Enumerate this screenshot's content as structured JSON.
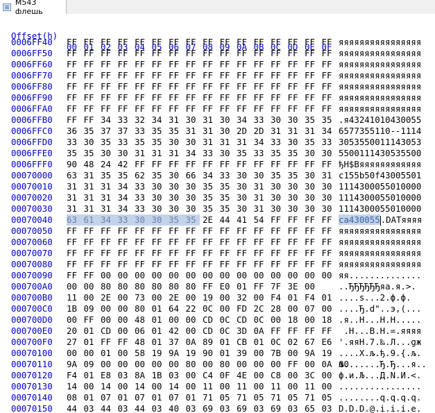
{
  "tab": {
    "label": "M543 флешь",
    "icon": "document-icon"
  },
  "header": {
    "offset_label": "Offset(h)",
    "columns": [
      "00",
      "01",
      "02",
      "03",
      "04",
      "05",
      "06",
      "07",
      "08",
      "09",
      "0A",
      "0B",
      "0C",
      "0D",
      "0E",
      "0F"
    ]
  },
  "selection_color": "#c3d3ea",
  "offset_color": "#0000c8",
  "rows": [
    {
      "offset": "0006FF40",
      "hex": [
        "FF",
        "FF",
        "FF",
        "FF",
        "FF",
        "FF",
        "FF",
        "FF",
        "FF",
        "FF",
        "FF",
        "FF",
        "FF",
        "FF",
        "FF",
        "FF"
      ],
      "ascii": "яяяяяяяяяяяяяяяя"
    },
    {
      "offset": "0006FF50",
      "hex": [
        "FF",
        "FF",
        "FF",
        "FF",
        "FF",
        "FF",
        "FF",
        "FF",
        "FF",
        "FF",
        "FF",
        "FF",
        "FF",
        "FF",
        "FF",
        "FF"
      ],
      "ascii": "яяяяяяяяяяяяяяяя"
    },
    {
      "offset": "0006FF60",
      "hex": [
        "FF",
        "FF",
        "FF",
        "FF",
        "FF",
        "FF",
        "FF",
        "FF",
        "FF",
        "FF",
        "FF",
        "FF",
        "FF",
        "FF",
        "FF",
        "FF"
      ],
      "ascii": "яяяяяяяяяяяяяяяя"
    },
    {
      "offset": "0006FF70",
      "hex": [
        "FF",
        "FF",
        "FF",
        "FF",
        "FF",
        "FF",
        "FF",
        "FF",
        "FF",
        "FF",
        "FF",
        "FF",
        "FF",
        "FF",
        "FF",
        "FF"
      ],
      "ascii": "яяяяяяяяяяяяяяяя"
    },
    {
      "offset": "0006FF80",
      "hex": [
        "FF",
        "FF",
        "FF",
        "FF",
        "FF",
        "FF",
        "FF",
        "FF",
        "FF",
        "FF",
        "FF",
        "FF",
        "FF",
        "FF",
        "FF",
        "FF"
      ],
      "ascii": "яяяяяяяяяяяяяяяя"
    },
    {
      "offset": "0006FF90",
      "hex": [
        "FF",
        "FF",
        "FF",
        "FF",
        "FF",
        "FF",
        "FF",
        "FF",
        "FF",
        "FF",
        "FF",
        "FF",
        "FF",
        "FF",
        "FF",
        "FF"
      ],
      "ascii": "яяяяяяяяяяяяяяяя"
    },
    {
      "offset": "0006FFA0",
      "hex": [
        "FF",
        "FF",
        "FF",
        "FF",
        "FF",
        "FF",
        "FF",
        "FF",
        "FF",
        "FF",
        "FF",
        "FF",
        "FF",
        "FF",
        "FF",
        "FF"
      ],
      "ascii": "яяяяяяяяяяяяяяяя"
    },
    {
      "offset": "0006FFB0",
      "hex": [
        "FF",
        "FF",
        "34",
        "33",
        "32",
        "34",
        "31",
        "30",
        "31",
        "30",
        "34",
        "33",
        "30",
        "30",
        "35",
        "35"
      ],
      "ascii": ".я43241010430055"
    },
    {
      "offset": "0006FFC0",
      "hex": [
        "36",
        "35",
        "37",
        "37",
        "33",
        "35",
        "35",
        "31",
        "31",
        "30",
        "2D",
        "2D",
        "31",
        "31",
        "31",
        "34"
      ],
      "ascii": "6577355110--1114"
    },
    {
      "offset": "0006FFD0",
      "hex": [
        "33",
        "30",
        "35",
        "33",
        "35",
        "35",
        "30",
        "30",
        "31",
        "31",
        "31",
        "34",
        "33",
        "30",
        "35",
        "33"
      ],
      "ascii": "3053550011143053"
    },
    {
      "offset": "0006FFE0",
      "hex": [
        "35",
        "35",
        "30",
        "30",
        "31",
        "31",
        "31",
        "34",
        "33",
        "30",
        "35",
        "33",
        "35",
        "35",
        "30",
        "30"
      ],
      "ascii": "5500111430535500"
    },
    {
      "offset": "0006FFF0",
      "hex": [
        "90",
        "48",
        "24",
        "42",
        "FF",
        "FF",
        "FF",
        "FF",
        "FF",
        "FF",
        "FF",
        "FF",
        "FF",
        "FF",
        "FF",
        "FF"
      ],
      "ascii": "ђH$Bяяяяяяяяяяяя"
    },
    {
      "offset": "00070000",
      "hex": [
        "63",
        "31",
        "35",
        "35",
        "62",
        "35",
        "30",
        "66",
        "34",
        "33",
        "30",
        "30",
        "35",
        "35",
        "30",
        "31"
      ],
      "ascii": "c155b50f43005501"
    },
    {
      "offset": "00070010",
      "hex": [
        "31",
        "31",
        "31",
        "34",
        "33",
        "30",
        "30",
        "30",
        "35",
        "35",
        "30",
        "31",
        "30",
        "30",
        "30",
        "30"
      ],
      "ascii": "1114300055010000"
    },
    {
      "offset": "00070020",
      "hex": [
        "31",
        "31",
        "31",
        "34",
        "33",
        "30",
        "30",
        "30",
        "35",
        "35",
        "30",
        "31",
        "30",
        "30",
        "30",
        "30"
      ],
      "ascii": "1114300055010000"
    },
    {
      "offset": "00070030",
      "hex": [
        "31",
        "31",
        "31",
        "34",
        "33",
        "30",
        "30",
        "30",
        "35",
        "35",
        "30",
        "31",
        "30",
        "30",
        "30",
        "30"
      ],
      "ascii": "1114300055010000"
    },
    {
      "offset": "00070040",
      "hex": [
        "63",
        "61",
        "34",
        "33",
        "30",
        "30",
        "35",
        "35",
        "2E",
        "44",
        "41",
        "54",
        "FF",
        "FF",
        "FF",
        "FF"
      ],
      "ascii": "ca430055.DATяяяя",
      "sel_count": 8
    },
    {
      "offset": "00070050",
      "hex": [
        "FF",
        "FF",
        "FF",
        "FF",
        "FF",
        "FF",
        "FF",
        "FF",
        "FF",
        "FF",
        "FF",
        "FF",
        "FF",
        "FF",
        "FF",
        "FF"
      ],
      "ascii": "яяяяяяяяяяяяяяяя"
    },
    {
      "offset": "00070060",
      "hex": [
        "FF",
        "FF",
        "FF",
        "FF",
        "FF",
        "FF",
        "FF",
        "FF",
        "FF",
        "FF",
        "FF",
        "FF",
        "FF",
        "FF",
        "FF",
        "FF"
      ],
      "ascii": "яяяяяяяяяяяяяяяя"
    },
    {
      "offset": "00070070",
      "hex": [
        "FF",
        "FF",
        "FF",
        "FF",
        "FF",
        "FF",
        "FF",
        "FF",
        "FF",
        "FF",
        "FF",
        "FF",
        "FF",
        "FF",
        "FF",
        "FF"
      ],
      "ascii": "яяяяяяяяяяяяяяяя"
    },
    {
      "offset": "00070080",
      "hex": [
        "FF",
        "FF",
        "FF",
        "FF",
        "FF",
        "FF",
        "FF",
        "FF",
        "FF",
        "FF",
        "FF",
        "FF",
        "FF",
        "FF",
        "FF",
        "FF"
      ],
      "ascii": "яяяяяяяяяяяяяяяя"
    },
    {
      "offset": "00070090",
      "hex": [
        "FF",
        "FF",
        "00",
        "00",
        "00",
        "00",
        "00",
        "00",
        "00",
        "00",
        "00",
        "00",
        "00",
        "00",
        "00",
        "00"
      ],
      "ascii": "яя.............."
    },
    {
      "offset": "000700A0",
      "hex": [
        "00",
        "00",
        "80",
        "80",
        "80",
        "80",
        "80",
        "80",
        "FF",
        "E0",
        "01",
        "FF",
        "7F",
        "3E",
        "00"
      ],
      "ascii": "..ЂЂЂЂЂЂяа.я.>."
    },
    {
      "offset": "000700B0",
      "hex": [
        "11",
        "00",
        "2E",
        "00",
        "73",
        "00",
        "2E",
        "00",
        "19",
        "00",
        "32",
        "00",
        "F4",
        "01",
        "F4",
        "01"
      ],
      "ascii": "....s...2.ф.ф."
    },
    {
      "offset": "000700C0",
      "hex": [
        "1B",
        "09",
        "00",
        "00",
        "80",
        "01",
        "64",
        "22",
        "0C",
        "00",
        "FD",
        "2C",
        "28",
        "00",
        "07",
        "00"
      ],
      "ascii": "....Ђ.d\"..э,(..."
    },
    {
      "offset": "000700D0",
      "hex": [
        "00",
        "FF",
        "00",
        "00",
        "48",
        "01",
        "00",
        "00",
        "CD",
        "0C",
        "CD",
        "0C",
        "00",
        "18",
        "00",
        "18"
      ],
      "ascii": ".я..H...Н.Н....."
    },
    {
      "offset": "000700E0",
      "hex": [
        "20",
        "01",
        "CD",
        "00",
        "06",
        "01",
        "42",
        "00",
        "CD",
        "0C",
        "3D",
        "0A",
        "FF",
        "FF",
        "FF",
        "FF"
      ],
      "ascii": " .Н...B.Н.=.яяяя"
    },
    {
      "offset": "000700F0",
      "hex": [
        "27",
        "01",
        "FF",
        "FF",
        "48",
        "01",
        "37",
        "0A",
        "89",
        "01",
        "CB",
        "01",
        "0C",
        "02",
        "67",
        "E6"
      ],
      "ascii": "'.яяH.7.‰.Л...gж"
    },
    {
      "offset": "00070100",
      "hex": [
        "00",
        "00",
        "01",
        "00",
        "58",
        "19",
        "9A",
        "19",
        "90",
        "01",
        "39",
        "00",
        "7B",
        "00",
        "9A",
        "19"
      ],
      "ascii": "....X.љ.ђ.9.{.љ."
    },
    {
      "offset": "00070110",
      "hex": [
        "9A",
        "09",
        "00",
        "00",
        "00",
        "00",
        "00",
        "80",
        "00",
        "80",
        "00",
        "00",
        "00",
        "FF",
        "00",
        "0A",
        "00"
      ],
      "ascii": "љ.......Ђ.Ђ...я.."
    },
    {
      "offset": "00070120",
      "hex": [
        "F4",
        "01",
        "E8",
        "03",
        "8A",
        "1B",
        "03",
        "00",
        "C4",
        "0F",
        "4E",
        "00",
        "C8",
        "00",
        "3C",
        "00"
      ],
      "ascii": "ф.и.Љ...Д.N.И.<."
    },
    {
      "offset": "00070130",
      "hex": [
        "14",
        "00",
        "14",
        "00",
        "14",
        "00",
        "14",
        "00",
        "11",
        "00",
        "11",
        "00",
        "11",
        "00",
        "11",
        "00"
      ],
      "ascii": "................"
    },
    {
      "offset": "00070140",
      "hex": [
        "08",
        "01",
        "07",
        "01",
        "07",
        "01",
        "07",
        "01",
        "71",
        "05",
        "71",
        "05",
        "71",
        "05",
        "71",
        "05"
      ],
      "ascii": "........q.q.q.q."
    },
    {
      "offset": "00070150",
      "hex": [
        "44",
        "03",
        "44",
        "03",
        "44",
        "03",
        "40",
        "03",
        "69",
        "03",
        "69",
        "03",
        "69",
        "03",
        "65",
        "03"
      ],
      "ascii": "D.D.D.@.i.i.i.e."
    }
  ]
}
